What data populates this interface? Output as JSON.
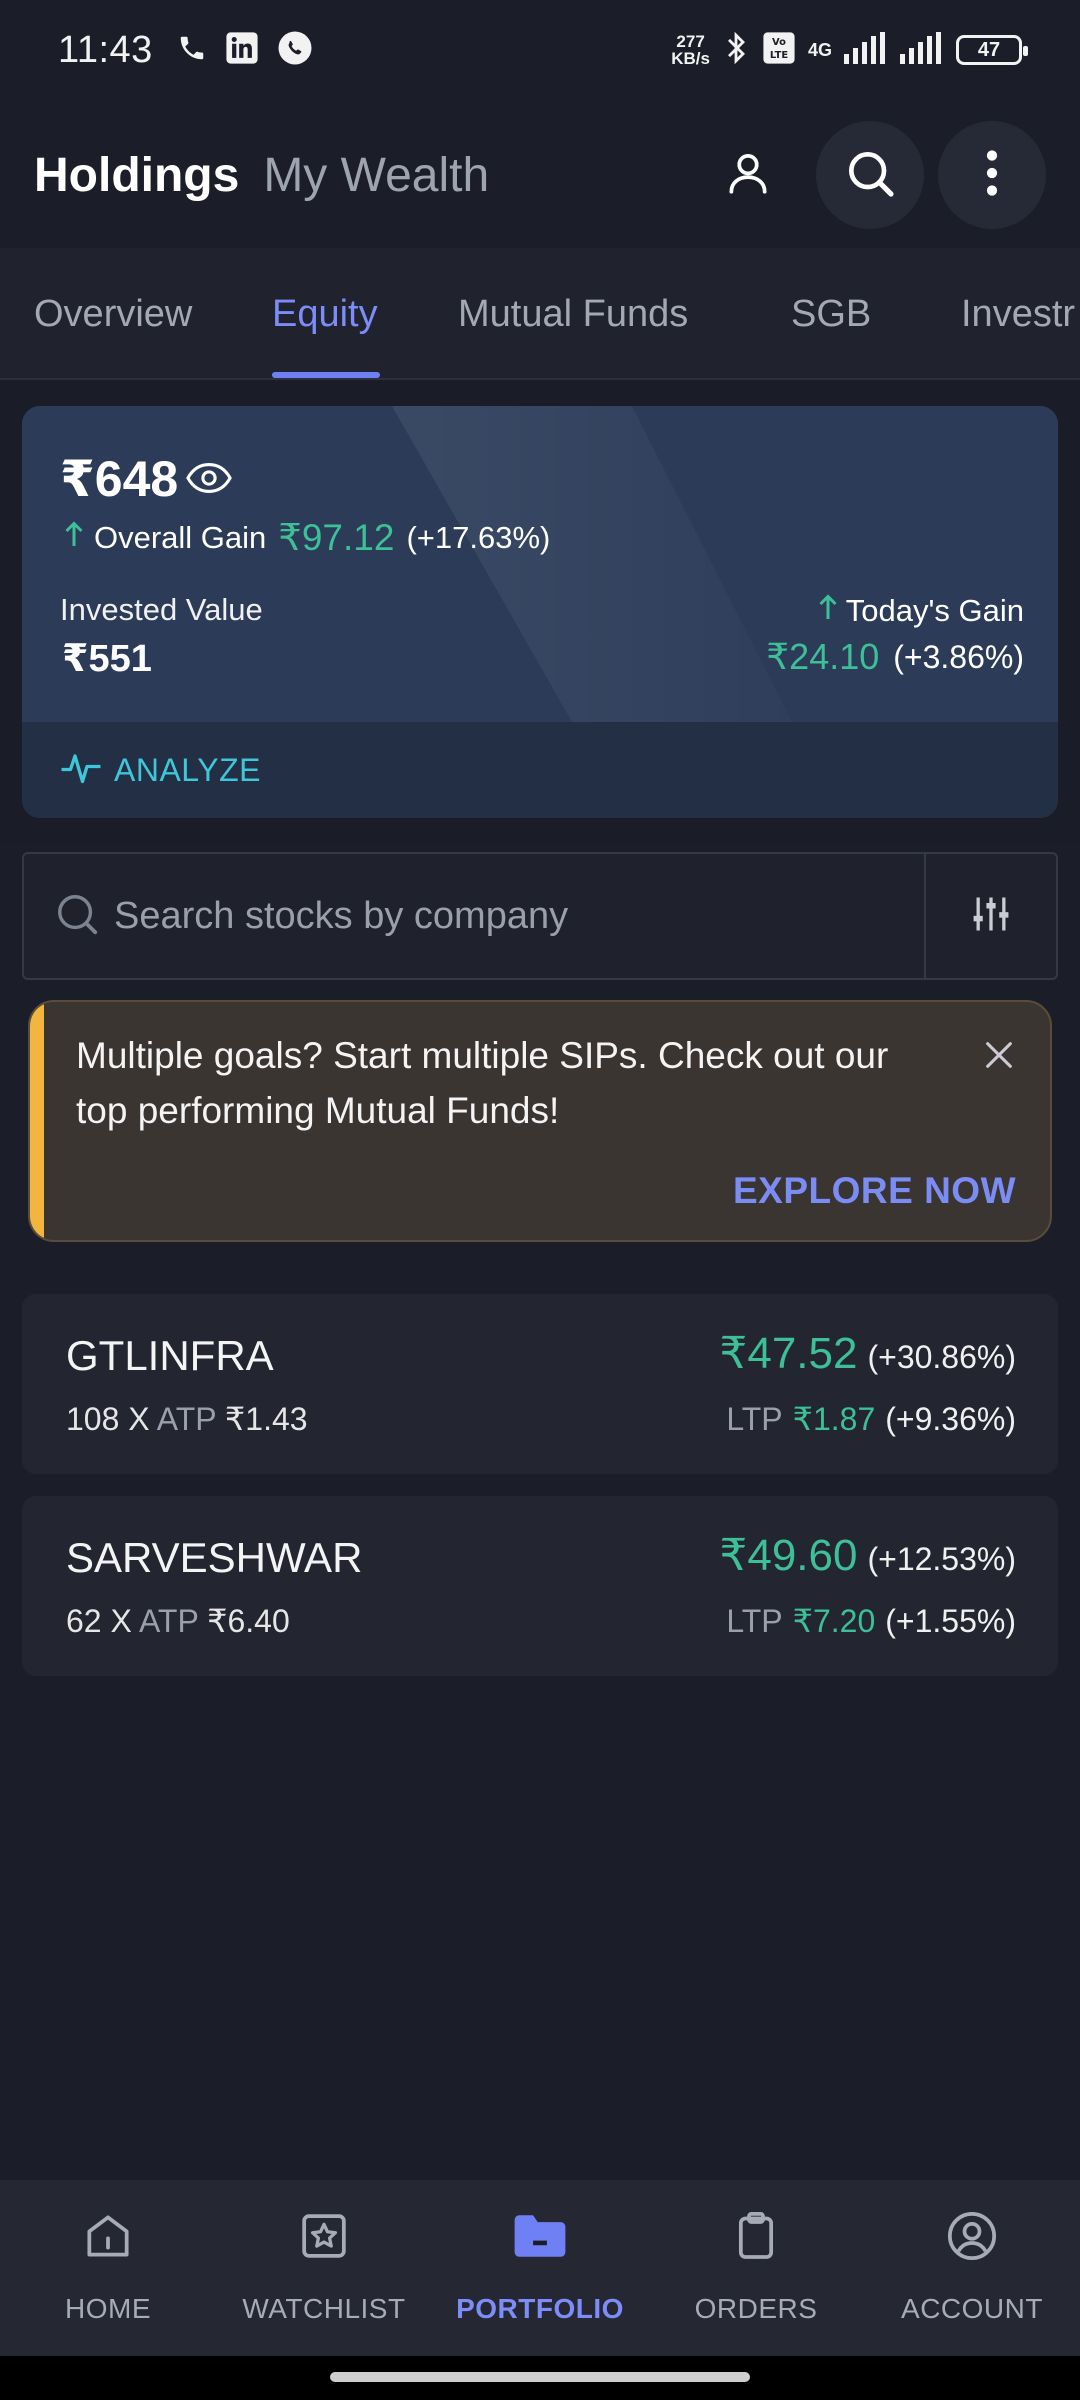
{
  "status_bar": {
    "time": "11:43",
    "speed_value": "277",
    "speed_unit": "KB/s",
    "network": "4G",
    "battery": "47",
    "icons": [
      "phone-icon",
      "linkedin-icon",
      "whatsapp-icon",
      "bluetooth-icon",
      "volte-icon",
      "signal-icon",
      "battery-icon"
    ]
  },
  "header": {
    "title": "Holdings",
    "subtitle": "My Wealth",
    "icons": [
      "profile-icon",
      "search-icon",
      "more-vert-icon"
    ]
  },
  "tabs": [
    {
      "label": "Overview",
      "active": false
    },
    {
      "label": "Equity",
      "active": true
    },
    {
      "label": "Mutual Funds",
      "active": false
    },
    {
      "label": "SGB",
      "active": false
    },
    {
      "label": "Investr",
      "active": false
    }
  ],
  "summary": {
    "current_value": "₹648",
    "overall_gain_label": "Overall Gain",
    "overall_gain_value": "₹97.12",
    "overall_gain_pct": "(+17.63%)",
    "invested_label": "Invested Value",
    "invested_value": "₹551",
    "today_gain_label": "Today's Gain",
    "today_gain_value": "₹24.10",
    "today_gain_pct": "(+3.86%)",
    "analyze_label": "ANALYZE"
  },
  "search": {
    "placeholder": "Search stocks by company"
  },
  "banner": {
    "text": "Multiple goals? Start multiple SIPs. Check out our top performing Mutual Funds!",
    "cta": "EXPLORE NOW"
  },
  "holdings": [
    {
      "symbol": "GTLINFRA",
      "qty": "108 X",
      "atp_label": "ATP",
      "atp": "₹1.43",
      "value": "₹47.52",
      "value_pct": "(+30.86%)",
      "ltp_label": "LTP",
      "ltp": "₹1.87",
      "ltp_pct": "(+9.36%)"
    },
    {
      "symbol": "SARVESHWAR",
      "qty": "62 X",
      "atp_label": "ATP",
      "atp": "₹6.40",
      "value": "₹49.60",
      "value_pct": "(+12.53%)",
      "ltp_label": "LTP",
      "ltp": "₹7.20",
      "ltp_pct": "(+1.55%)"
    }
  ],
  "bottom_nav": [
    {
      "label": "HOME",
      "icon": "home-icon",
      "active": false
    },
    {
      "label": "WATCHLIST",
      "icon": "watchlist-star-icon",
      "active": false
    },
    {
      "label": "PORTFOLIO",
      "icon": "folder-icon",
      "active": true
    },
    {
      "label": "ORDERS",
      "icon": "clipboard-icon",
      "active": false
    },
    {
      "label": "ACCOUNT",
      "icon": "account-circle-icon",
      "active": false
    }
  ],
  "colors": {
    "background": "#1b1e28",
    "accent": "#7c8cf8",
    "gain_green": "#3dbf97",
    "analyze_cyan": "#3fc6d8",
    "banner_stripe": "#f2b640"
  }
}
